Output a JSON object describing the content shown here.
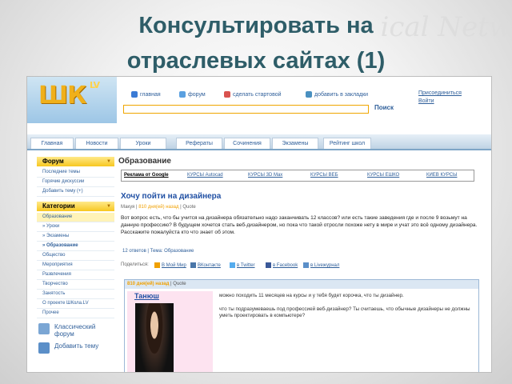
{
  "slide": {
    "title_line1": "Консультировать на",
    "title_line2": "отраслевых сайтах (1)",
    "bg_watermark": "ical Netw"
  },
  "site": {
    "logo": "ШК",
    "logo_sub": "LV",
    "topnav": [
      "главная",
      "форум",
      "сделать стартовой",
      "добавить в закладки"
    ],
    "join": [
      "Присоединиться",
      "Войти"
    ],
    "search_button": "Поиск",
    "search_value": "",
    "menu": [
      "Главная",
      "Новости",
      "Уроки",
      "Рефераты",
      "Сочинения",
      "Экзамены",
      "Рейтинг школ"
    ]
  },
  "sidebar": {
    "forum_head": "Форум",
    "forum_items": [
      "Последние темы",
      "Горячие дискуссии",
      "Добавить тему (+)"
    ],
    "cat_head": "Категории",
    "cat_items": [
      "Образование",
      "» Уроки",
      "» Экзамены",
      "» Образование",
      "Общество",
      "Мероприятия",
      "Развлечения",
      "Творчество",
      "Занятость",
      "О проекте ШКола.LV",
      "Прочее"
    ],
    "classic_forum": "Классический форум",
    "add_topic": "Добавить тему"
  },
  "main": {
    "section": "Образование",
    "ads": [
      "Реклама от Google",
      "КУРСЫ Autocad",
      "КУРСЫ 3D Max",
      "КУРСЫ ВЕБ",
      "КУРСЫ ЕШКО",
      "КИЕВ КУРСЫ"
    ],
    "topic_title": "Хочу пойти на дизайнера",
    "meta_author": "Макуя",
    "meta_time": "810 дня(ей) назад",
    "meta_quote": "Quote",
    "body": "Вот вопрос есть, что бы учится на дизайнера обязательно надо заканчивать 12 классов? или есть такие заведения где и после 9 возьмут на данную профессию? В будущем хочется стать веб-дизайнером, но пока что такой отросли похоже нету в мире и учат это всё одному дизайнера. Расскажите пожалуйста кто что знает об этом.",
    "replies": "12 ответов | Тема: Образование",
    "share_label": "Поделиться:",
    "share": [
      "В Мой Мир",
      "ВКонтакте",
      "в Twitter",
      "в Facebook",
      "в Liveжурнал"
    ],
    "post_meta_time": "810 дня(ей) назад",
    "post_meta_quote": "Quote",
    "post_author": "Танюш",
    "post_msg1": "можно походить 11 месяцев на курсы и у тебя будет корочка, что ты дизайнер.",
    "post_msg2": "что ты подразумеваешь под профессией веб-дизайнер? Ты считаешь, что обычные дизайнеры не должны уметь проектировать в компьютере?"
  },
  "colors": {
    "title": "#2e5d68",
    "link": "#2f5f9a",
    "accent": "#f0b01a"
  }
}
